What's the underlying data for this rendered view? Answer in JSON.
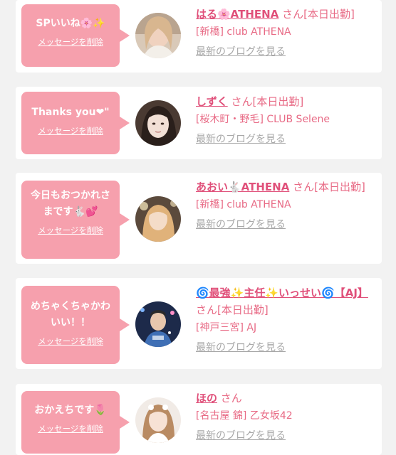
{
  "rows": [
    {
      "message": "SPいいね🌸✨",
      "delete_label": "メッセージを削除",
      "name": "はる🌸ATHENA",
      "status": "さん[本日出勤]",
      "shop": "[新橋] club ATHENA",
      "blog_link": "最新のブログを見る"
    },
    {
      "message": "Thanks you❤\"",
      "delete_label": "メッセージを削除",
      "name": "しずく",
      "status": "さん[本日出勤]",
      "shop": "[桜木町・野毛] CLUB Selene",
      "blog_link": "最新のブログを見る"
    },
    {
      "message": "今日もおつかれさまです🐇💕",
      "delete_label": "メッセージを削除",
      "name": "あおい🐇ATHENA",
      "status": "さん[本日出勤]",
      "shop": "[新橋] club ATHENA",
      "blog_link": "最新のブログを見る"
    },
    {
      "message": "めちゃくちゃかわいい！！",
      "delete_label": "メッセージを削除",
      "name": "🌀最強✨主任✨いっせい🌀【AJ】",
      "status": "さん[本日出勤]",
      "shop": "[神戸三宮] AJ",
      "blog_link": "最新のブログを見る"
    },
    {
      "message": "おかえちです🌷",
      "delete_label": "メッセージを削除",
      "name": "ほの",
      "status": "さん",
      "shop": "[名古屋 錦] 乙女坂42",
      "blog_link": "最新のブログを見る"
    }
  ],
  "colors": {
    "bubble": "#f6a0ad",
    "name": "#e0507a",
    "text_pink": "#e86a85",
    "link_gray": "#a8a8a8"
  }
}
